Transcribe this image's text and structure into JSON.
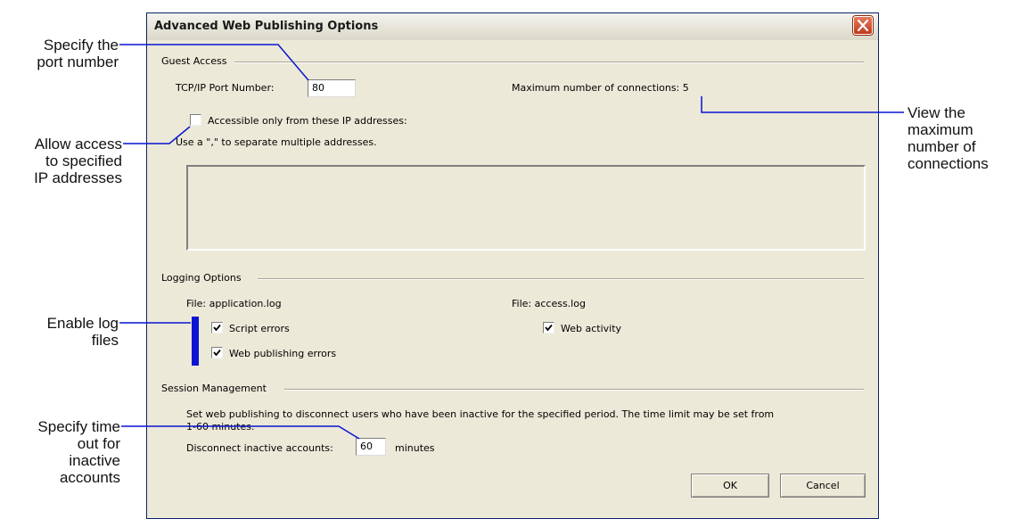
{
  "dialog": {
    "title": "Advanced Web Publishing Options",
    "close_icon": "close-x-icon"
  },
  "guest_access": {
    "label": "Guest Access",
    "port_label": "TCP/IP Port Number:",
    "port_value": "80",
    "max_connections_text": "Maximum number of connections: 5",
    "ip_checkbox_label": "Accessible only from these IP addresses:",
    "ip_checkbox_checked": false,
    "separator_hint": "Use a \",\" to separate multiple addresses.",
    "ip_addresses_value": ""
  },
  "logging": {
    "label": "Logging Options",
    "app_file_label": "File: application.log",
    "access_file_label": "File: access.log",
    "script_errors_label": "Script errors",
    "script_errors_checked": true,
    "web_publishing_errors_label": "Web publishing errors",
    "web_publishing_errors_checked": true,
    "web_activity_label": "Web activity",
    "web_activity_checked": true
  },
  "session": {
    "label": "Session Management",
    "description_line1": "Set web publishing to disconnect users who have been inactive for the specified period.  The time limit may be set from",
    "description_line2": "1-60 minutes.",
    "disconnect_label": "Disconnect inactive accounts:",
    "disconnect_value": "60",
    "minutes_label": "minutes"
  },
  "buttons": {
    "ok": "OK",
    "cancel": "Cancel"
  },
  "callouts": {
    "port": [
      "Specify the",
      "port number"
    ],
    "ip": [
      "Allow access",
      "to specified",
      "IP addresses"
    ],
    "logs": [
      "Enable log",
      "files"
    ],
    "timeout": [
      "Specify time",
      "out for",
      "inactive",
      "accounts"
    ],
    "max_connections": [
      "View the",
      "maximum",
      "number of",
      "connections"
    ]
  },
  "colors": {
    "callout_line": "#0a14d2",
    "dialog_bg": "#ece9d8",
    "close_button": "#d14a28"
  }
}
